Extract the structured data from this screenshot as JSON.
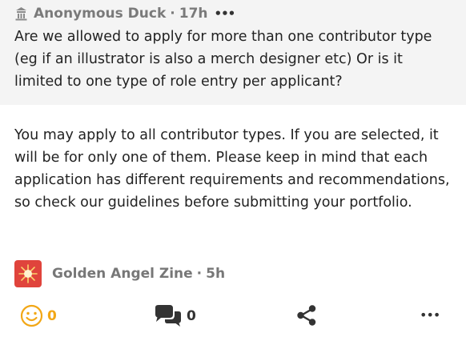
{
  "question": {
    "author": "Anonymous Duck",
    "separator": "·",
    "time": "17h",
    "more_label": "•••",
    "text": "Are we allowed to apply for more than one contributor type (eg if an illustrator is also a merch designer etc) Or is it limited to one type of role entry per applicant?"
  },
  "answer": {
    "text": "You may apply to all contributor types. If you are selected, it will be for only one of them. Please keep in mind that each application has different requirements and recommendations, so check our guidelines before submitting your portfolio.",
    "author": "Golden Angel Zine",
    "separator": "·",
    "time": "5h"
  },
  "actions": {
    "reactions_count": "0",
    "comments_count": "0",
    "more_label": "•••"
  },
  "colors": {
    "question_bg": "#f4f4f4",
    "reaction_accent": "#f2a716",
    "avatar_bg": "#e0443c"
  },
  "icons": [
    "ghost-icon",
    "smile-icon",
    "comment-icon",
    "share-icon",
    "more-icon"
  ]
}
